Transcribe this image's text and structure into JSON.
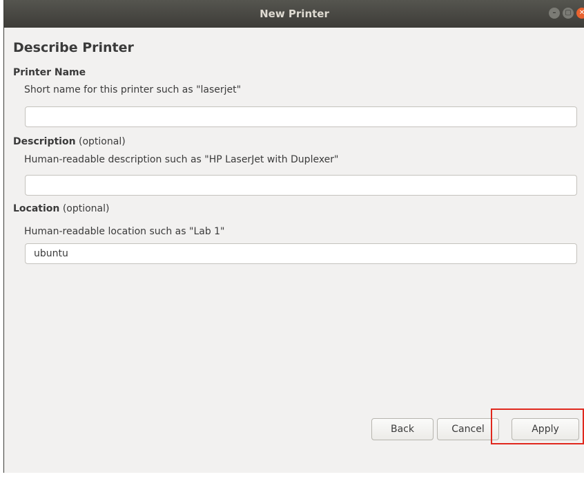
{
  "window": {
    "title": "New Printer",
    "controls": {
      "minimize_glyph": "–",
      "maximize_glyph": "▢",
      "close_glyph": "✕"
    }
  },
  "page": {
    "heading": "Describe Printer",
    "printer_name": {
      "label": "Printer Name",
      "hint": "Short name for this printer such as \"laserjet\"",
      "value": ""
    },
    "description": {
      "label": "Description",
      "label_suffix": " (optional)",
      "hint": "Human-readable description such as \"HP LaserJet with Duplexer\"",
      "value": ""
    },
    "location": {
      "label": "Location",
      "label_suffix": " (optional)",
      "hint": "Human-readable location such as \"Lab 1\"",
      "value": "ubuntu"
    }
  },
  "buttons": {
    "back": "Back",
    "cancel": "Cancel",
    "apply": "Apply"
  },
  "colors": {
    "titlebar": "#3d3c38",
    "window_bg": "#f2f1f0",
    "close_button": "#e9632f",
    "highlight_box": "#e0271d"
  }
}
